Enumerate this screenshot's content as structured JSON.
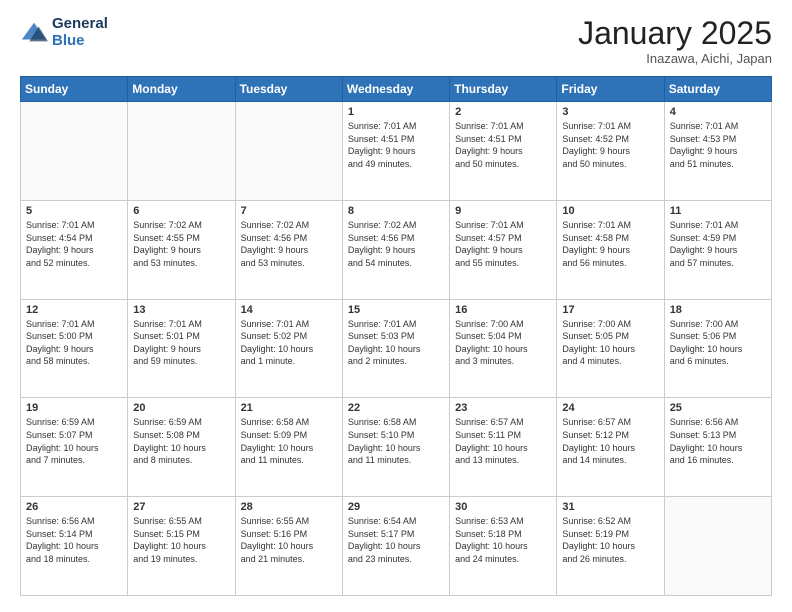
{
  "header": {
    "logo_line1": "General",
    "logo_line2": "Blue",
    "month": "January 2025",
    "location": "Inazawa, Aichi, Japan"
  },
  "weekdays": [
    "Sunday",
    "Monday",
    "Tuesday",
    "Wednesday",
    "Thursday",
    "Friday",
    "Saturday"
  ],
  "weeks": [
    [
      {
        "day": "",
        "info": ""
      },
      {
        "day": "",
        "info": ""
      },
      {
        "day": "",
        "info": ""
      },
      {
        "day": "1",
        "info": "Sunrise: 7:01 AM\nSunset: 4:51 PM\nDaylight: 9 hours\nand 49 minutes."
      },
      {
        "day": "2",
        "info": "Sunrise: 7:01 AM\nSunset: 4:51 PM\nDaylight: 9 hours\nand 50 minutes."
      },
      {
        "day": "3",
        "info": "Sunrise: 7:01 AM\nSunset: 4:52 PM\nDaylight: 9 hours\nand 50 minutes."
      },
      {
        "day": "4",
        "info": "Sunrise: 7:01 AM\nSunset: 4:53 PM\nDaylight: 9 hours\nand 51 minutes."
      }
    ],
    [
      {
        "day": "5",
        "info": "Sunrise: 7:01 AM\nSunset: 4:54 PM\nDaylight: 9 hours\nand 52 minutes."
      },
      {
        "day": "6",
        "info": "Sunrise: 7:02 AM\nSunset: 4:55 PM\nDaylight: 9 hours\nand 53 minutes."
      },
      {
        "day": "7",
        "info": "Sunrise: 7:02 AM\nSunset: 4:56 PM\nDaylight: 9 hours\nand 53 minutes."
      },
      {
        "day": "8",
        "info": "Sunrise: 7:02 AM\nSunset: 4:56 PM\nDaylight: 9 hours\nand 54 minutes."
      },
      {
        "day": "9",
        "info": "Sunrise: 7:01 AM\nSunset: 4:57 PM\nDaylight: 9 hours\nand 55 minutes."
      },
      {
        "day": "10",
        "info": "Sunrise: 7:01 AM\nSunset: 4:58 PM\nDaylight: 9 hours\nand 56 minutes."
      },
      {
        "day": "11",
        "info": "Sunrise: 7:01 AM\nSunset: 4:59 PM\nDaylight: 9 hours\nand 57 minutes."
      }
    ],
    [
      {
        "day": "12",
        "info": "Sunrise: 7:01 AM\nSunset: 5:00 PM\nDaylight: 9 hours\nand 58 minutes."
      },
      {
        "day": "13",
        "info": "Sunrise: 7:01 AM\nSunset: 5:01 PM\nDaylight: 9 hours\nand 59 minutes."
      },
      {
        "day": "14",
        "info": "Sunrise: 7:01 AM\nSunset: 5:02 PM\nDaylight: 10 hours\nand 1 minute."
      },
      {
        "day": "15",
        "info": "Sunrise: 7:01 AM\nSunset: 5:03 PM\nDaylight: 10 hours\nand 2 minutes."
      },
      {
        "day": "16",
        "info": "Sunrise: 7:00 AM\nSunset: 5:04 PM\nDaylight: 10 hours\nand 3 minutes."
      },
      {
        "day": "17",
        "info": "Sunrise: 7:00 AM\nSunset: 5:05 PM\nDaylight: 10 hours\nand 4 minutes."
      },
      {
        "day": "18",
        "info": "Sunrise: 7:00 AM\nSunset: 5:06 PM\nDaylight: 10 hours\nand 6 minutes."
      }
    ],
    [
      {
        "day": "19",
        "info": "Sunrise: 6:59 AM\nSunset: 5:07 PM\nDaylight: 10 hours\nand 7 minutes."
      },
      {
        "day": "20",
        "info": "Sunrise: 6:59 AM\nSunset: 5:08 PM\nDaylight: 10 hours\nand 8 minutes."
      },
      {
        "day": "21",
        "info": "Sunrise: 6:58 AM\nSunset: 5:09 PM\nDaylight: 10 hours\nand 11 minutes."
      },
      {
        "day": "22",
        "info": "Sunrise: 6:58 AM\nSunset: 5:10 PM\nDaylight: 10 hours\nand 11 minutes."
      },
      {
        "day": "23",
        "info": "Sunrise: 6:57 AM\nSunset: 5:11 PM\nDaylight: 10 hours\nand 13 minutes."
      },
      {
        "day": "24",
        "info": "Sunrise: 6:57 AM\nSunset: 5:12 PM\nDaylight: 10 hours\nand 14 minutes."
      },
      {
        "day": "25",
        "info": "Sunrise: 6:56 AM\nSunset: 5:13 PM\nDaylight: 10 hours\nand 16 minutes."
      }
    ],
    [
      {
        "day": "26",
        "info": "Sunrise: 6:56 AM\nSunset: 5:14 PM\nDaylight: 10 hours\nand 18 minutes."
      },
      {
        "day": "27",
        "info": "Sunrise: 6:55 AM\nSunset: 5:15 PM\nDaylight: 10 hours\nand 19 minutes."
      },
      {
        "day": "28",
        "info": "Sunrise: 6:55 AM\nSunset: 5:16 PM\nDaylight: 10 hours\nand 21 minutes."
      },
      {
        "day": "29",
        "info": "Sunrise: 6:54 AM\nSunset: 5:17 PM\nDaylight: 10 hours\nand 23 minutes."
      },
      {
        "day": "30",
        "info": "Sunrise: 6:53 AM\nSunset: 5:18 PM\nDaylight: 10 hours\nand 24 minutes."
      },
      {
        "day": "31",
        "info": "Sunrise: 6:52 AM\nSunset: 5:19 PM\nDaylight: 10 hours\nand 26 minutes."
      },
      {
        "day": "",
        "info": ""
      }
    ]
  ]
}
